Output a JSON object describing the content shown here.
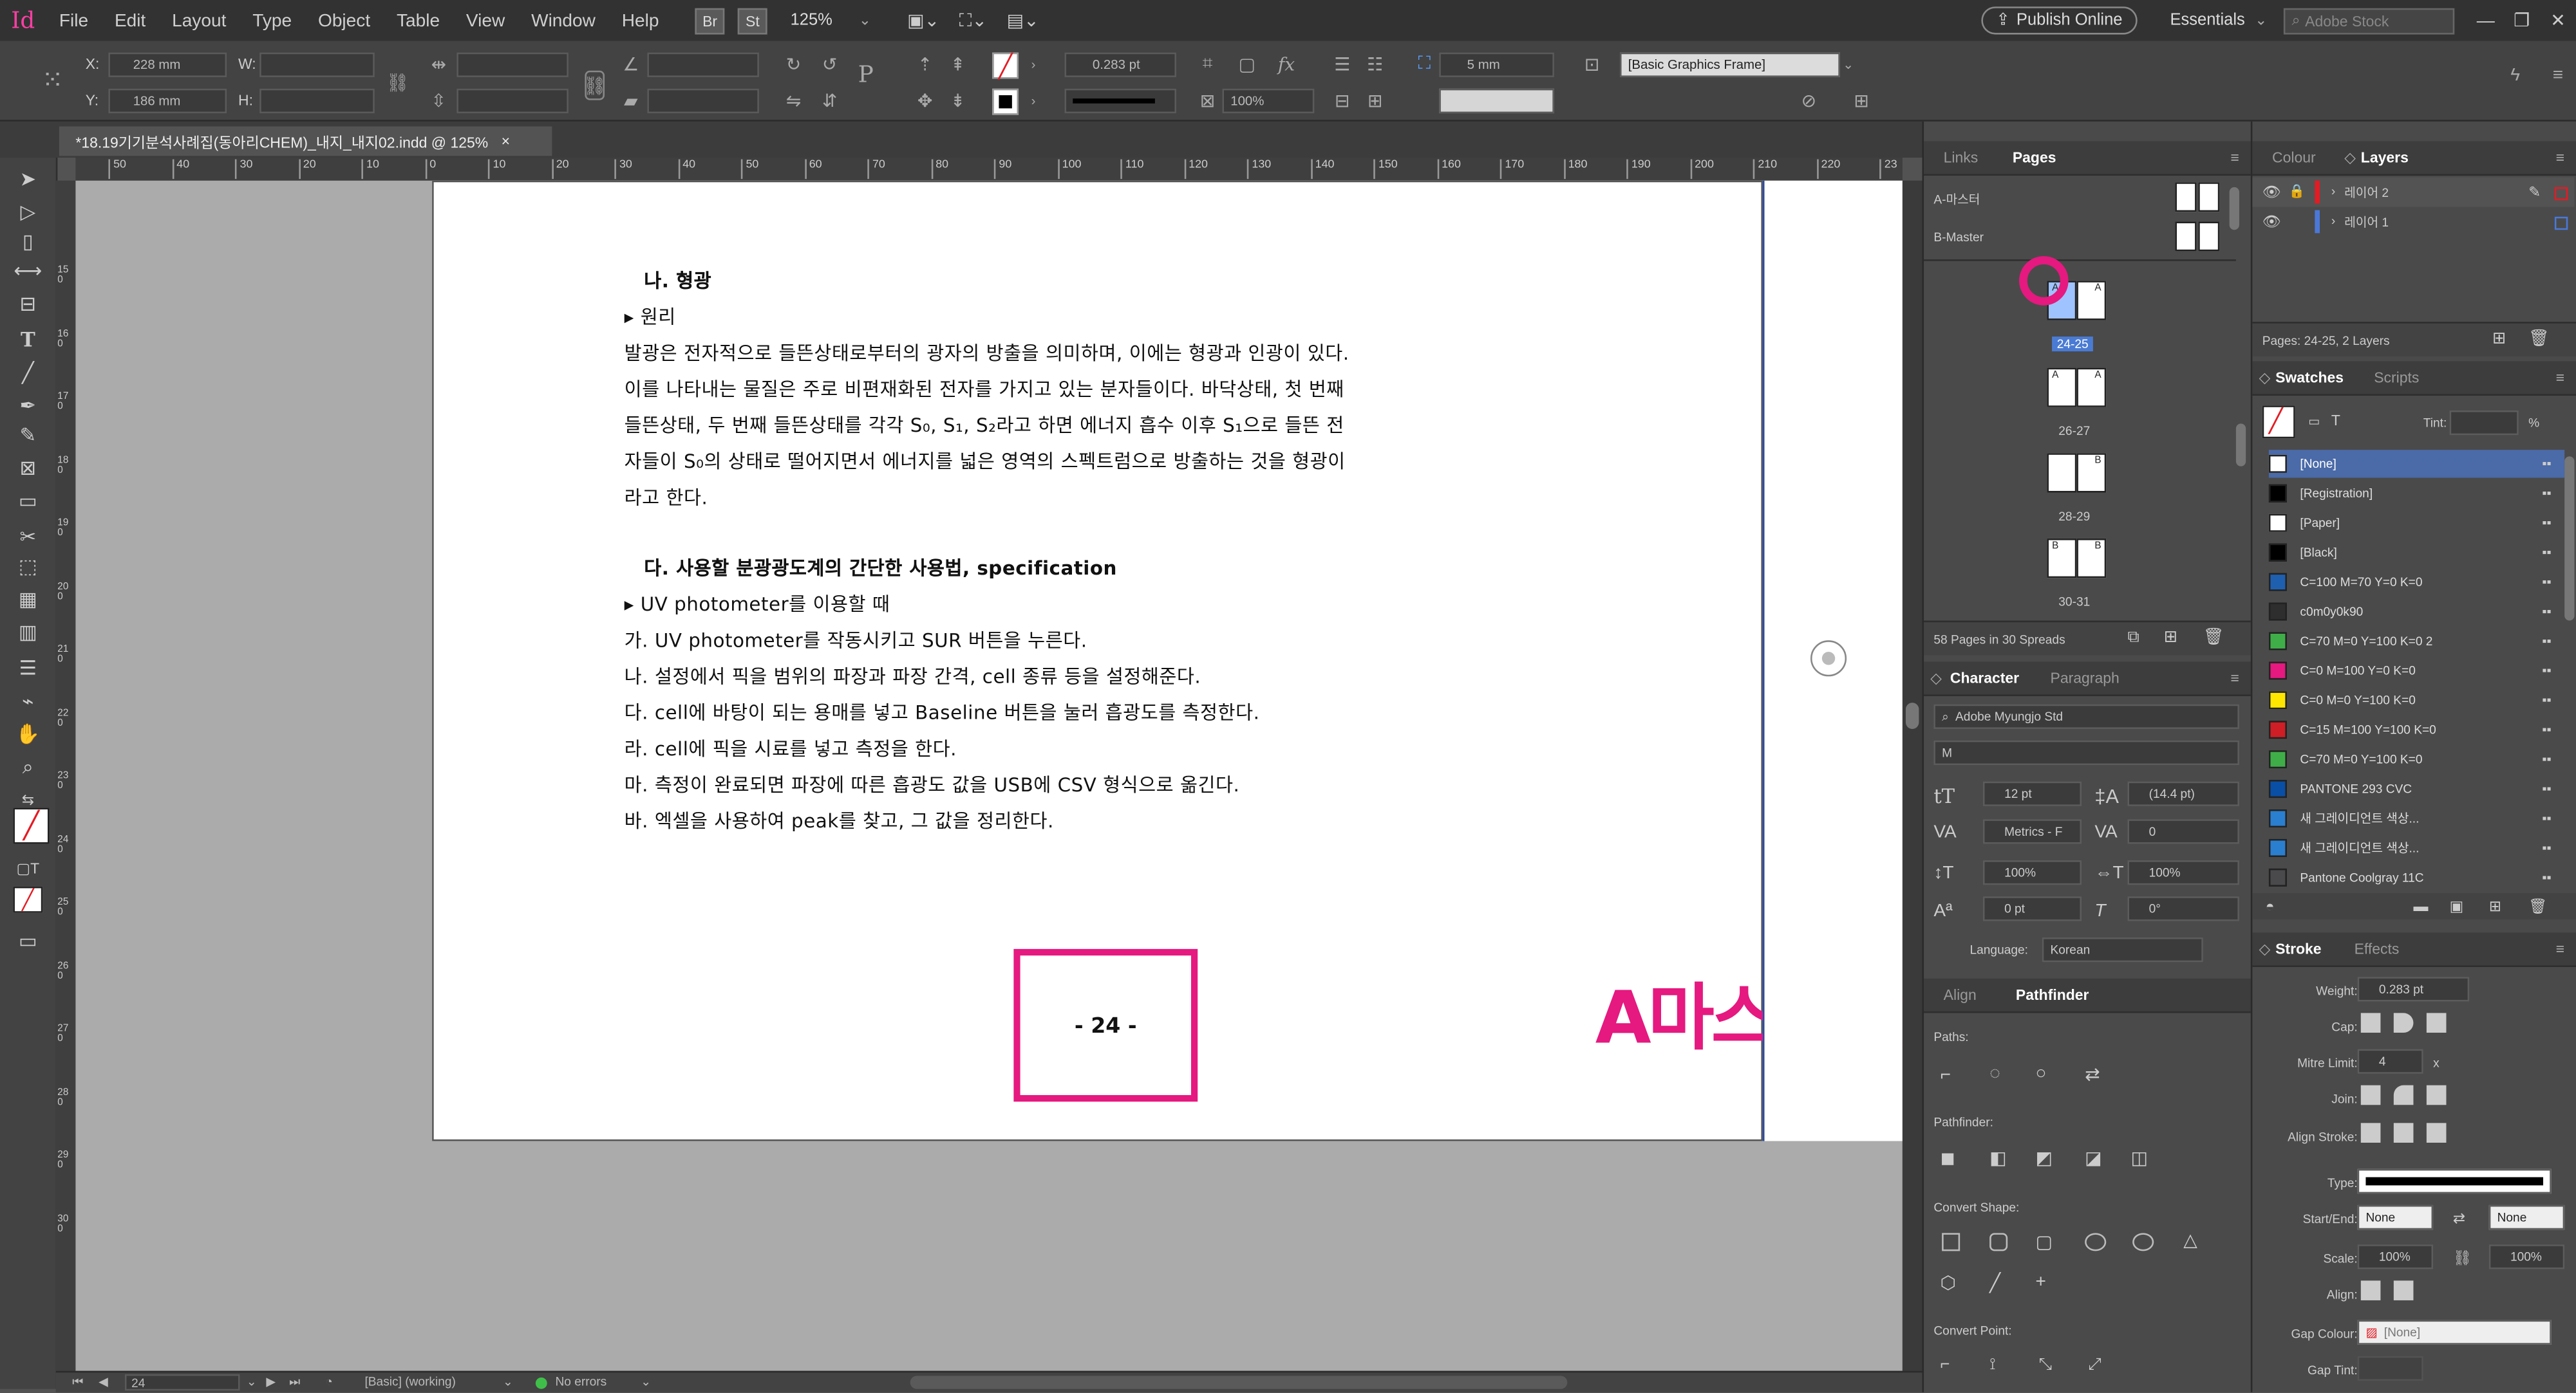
{
  "app": {
    "logo": "Id"
  },
  "menu": [
    "File",
    "Edit",
    "Layout",
    "Type",
    "Object",
    "Table",
    "View",
    "Window",
    "Help"
  ],
  "menubar": {
    "br_label": "Br",
    "st_label": "St",
    "zoom": "125%",
    "publish": "Publish Online",
    "workspace": "Essentials",
    "stock_placeholder": "Adobe Stock"
  },
  "control": {
    "x_label": "X:",
    "x_value": "228 mm",
    "y_label": "Y:",
    "y_value": "186 mm",
    "w_label": "W:",
    "h_label": "H:",
    "stroke_weight": "0.283 pt",
    "scale_pct": "100%",
    "spacing": "5 mm",
    "frame_style": "[Basic Graphics Frame]"
  },
  "tab": {
    "title": "*18.19기기분석사례집(동아리CHEM)_내지_내지02.indd @ 125%",
    "close": "×"
  },
  "ruler": {
    "h_ticks": [
      "50",
      "40",
      "30",
      "20",
      "10",
      "0",
      "10",
      "20",
      "30",
      "40",
      "50",
      "60",
      "70",
      "80",
      "90",
      "100",
      "110",
      "120",
      "130",
      "140",
      "150",
      "160",
      "170",
      "180",
      "190",
      "200",
      "210",
      "220",
      "23"
    ],
    "v_ticks": [
      "1 5 0",
      "1 6 0",
      "1 7 0",
      "1 8 0",
      "1 9 0",
      "2 0 0",
      "2 1 0",
      "2 2 0",
      "2 3 0",
      "2 4 0",
      "2 5 0",
      "2 6 0",
      "2 7 0",
      "2 8 0",
      "2 9 0",
      "3 0 0"
    ]
  },
  "document": {
    "lines": [
      "나. 형광",
      "▸ 원리",
      "발광은 전자적으로 들뜬상태로부터의 광자의 방출을 의미하며, 이에는 형광과 인광이 있다.",
      "이를 나타내는 물질은 주로 비편재화된 전자를 가지고 있는 분자들이다. 바닥상태, 첫 번째",
      "들뜬상태, 두 번째 들뜬상태를 각각 S₀, S₁, S₂라고 하면 에너지 흡수 이후 S₁으로 들뜬 전",
      "자들이 S₀의 상태로 떨어지면서 에너지를 넓은 영역의 스펙트럼으로 방출하는 것을 형광이",
      "라고 한다.",
      "다. 사용할 분광광도계의 간단한 사용법, specification",
      "▸ UV photometer를 이용할 때",
      "가. UV photometer를 작동시키고 SUR 버튼을 누른다.",
      "나. 설정에서 픽을 범위의 파장과 파장 간격, cell 종류 등을 설정해준다.",
      "다. cell에 바탕이 되는 용매를 넣고 Baseline 버튼을 눌러 흡광도를 측정한다.",
      "라. cell에 픽을 시료를 넣고 측정을 한다.",
      "마. 측정이 완료되면 파장에 따른 흡광도 값을 USB에 CSV 형식으로 옮긴다.",
      "바. 엑셀을 사용하여 peak를 찾고, 그 값을 정리한다."
    ],
    "page_number": "- 24 -",
    "annotation": "A마스터 선택페이지",
    "annotation_color": "#e5197f"
  },
  "status": {
    "page": "24",
    "style": "[Basic] (working)",
    "errors": "No errors"
  },
  "pages_panel": {
    "tabs": [
      "Links",
      "Pages"
    ],
    "masters": [
      "A-마스터",
      "B-Master"
    ],
    "spreads": [
      {
        "label": "24-25",
        "left": "A",
        "right": "A"
      },
      {
        "label": "26-27",
        "left": "A",
        "right": "A"
      },
      {
        "label": "28-29",
        "left": "",
        "right": "B"
      },
      {
        "label": "30-31",
        "left": "B",
        "right": "B"
      }
    ],
    "footer": "58 Pages in 30 Spreads"
  },
  "character_panel": {
    "tabs": [
      "Character",
      "Paragraph"
    ],
    "font": "Adobe Myungjo Std",
    "style": "M",
    "size": "12 pt",
    "leading": "(14.4 pt)",
    "kerning": "Metrics - F",
    "tracking": "0",
    "vscale": "100%",
    "hscale": "100%",
    "baseline": "0 pt",
    "skew": "0°",
    "language_label": "Language:",
    "language": "Korean"
  },
  "pathfinder_panel": {
    "tabs": [
      "Align",
      "Pathfinder"
    ],
    "paths": "Paths:",
    "pathfinder": "Pathfinder:",
    "convert_shape": "Convert Shape:",
    "convert_point": "Convert Point:"
  },
  "layers_panel": {
    "tabs": [
      "Colour",
      "Layers"
    ],
    "layers": [
      "레이어 2",
      "레이어 1"
    ],
    "footer": "Pages: 24-25, 2 Layers"
  },
  "swatches_panel": {
    "tabs": [
      "Swatches",
      "Scripts"
    ],
    "tint_label": "Tint:",
    "tint_unit": "%",
    "items": [
      {
        "name": "[None]",
        "color": "#ffffff",
        "selected": true
      },
      {
        "name": "[Registration]",
        "color": "#000000",
        "selected": false
      },
      {
        "name": "[Paper]",
        "color": "#ffffff",
        "selected": false
      },
      {
        "name": "[Black]",
        "color": "#000000",
        "selected": false
      },
      {
        "name": "C=100 M=70 Y=0 K=0",
        "color": "#1f5fb0",
        "selected": false
      },
      {
        "name": "c0m0y0k90",
        "color": "#2e2e2e",
        "selected": false
      },
      {
        "name": "C=70 M=0 Y=100 K=0 2",
        "color": "#3fae49",
        "selected": false
      },
      {
        "name": "C=0 M=100 Y=0 K=0",
        "color": "#e5197f",
        "selected": false
      },
      {
        "name": "C=0 M=0 Y=100 K=0",
        "color": "#ffe600",
        "selected": false
      },
      {
        "name": "C=15 M=100 Y=100 K=0",
        "color": "#cf1e25",
        "selected": false
      },
      {
        "name": "C=70 M=0 Y=100 K=0",
        "color": "#3fae49",
        "selected": false
      },
      {
        "name": "PANTONE 293 CVC",
        "color": "#0a4fa6",
        "selected": false
      },
      {
        "name": "새 그레이디언트 색상...",
        "color": "#2a7fd0",
        "selected": false
      },
      {
        "name": "새 그레이디언트 색상...",
        "color": "#2a7fd0",
        "selected": false
      },
      {
        "name": "Pantone Coolgray 11C",
        "color": "#4a4a4c",
        "selected": false
      }
    ]
  },
  "stroke_panel": {
    "tabs": [
      "Stroke",
      "Effects"
    ],
    "weight_label": "Weight:",
    "weight": "0.283 pt",
    "cap_label": "Cap:",
    "mitre_label": "Mitre Limit:",
    "mitre": "4",
    "mitre_unit": "x",
    "join_label": "Join:",
    "align_label": "Align Stroke:",
    "type_label": "Type:",
    "startend_label": "Start/End:",
    "start": "None",
    "end": "None",
    "scale_label": "Scale:",
    "scale_start": "100%",
    "scale_end": "100%",
    "align2_label": "Align:",
    "gap_colour_label": "Gap Colour:",
    "gap_colour": "[None]",
    "gap_tint_label": "Gap Tint:"
  }
}
